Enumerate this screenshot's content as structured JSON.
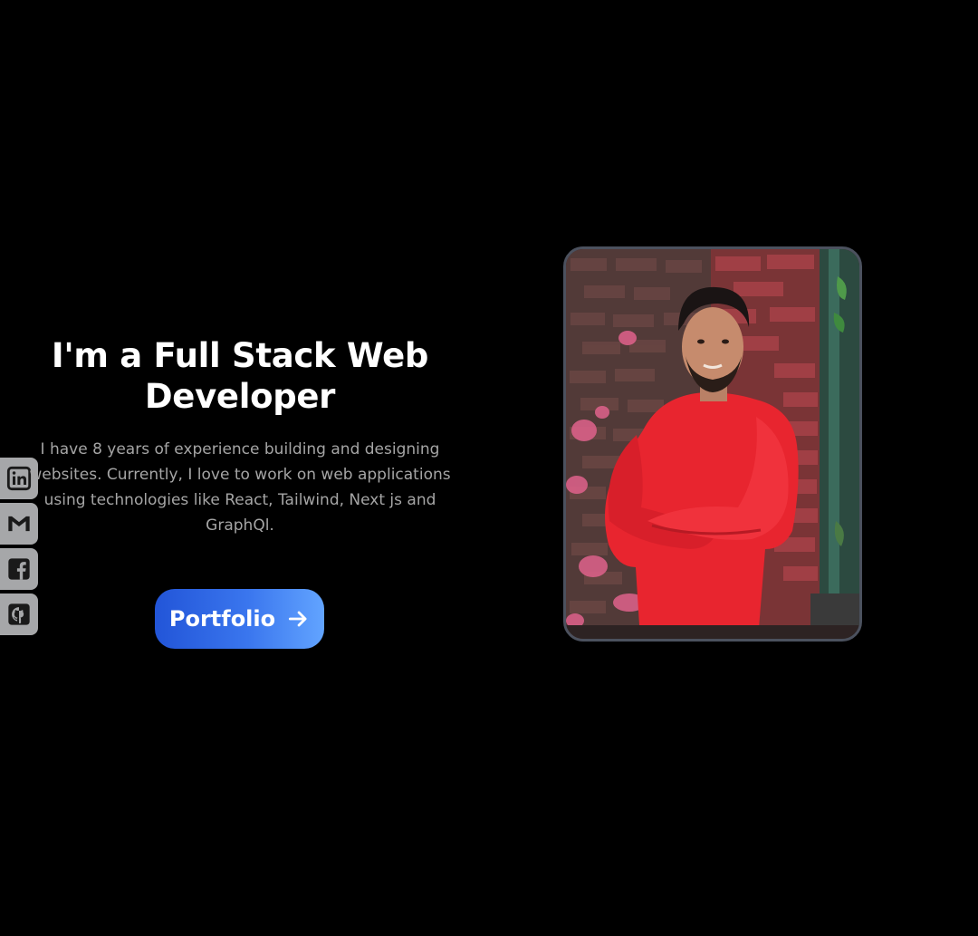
{
  "hero": {
    "title_line1": "I'm a Full Stack Web",
    "title_line2": "Developer",
    "description": "I have 8 years of experience building and designing websites. Currently, I love to work on web applications using technologies like React, Tailwind, Next js and GraphQl.",
    "cta_label": "Portfolio"
  },
  "social": [
    {
      "icon": "linkedin-icon"
    },
    {
      "icon": "gmail-icon"
    },
    {
      "icon": "facebook-icon"
    },
    {
      "icon": "github-icon"
    }
  ],
  "colors": {
    "background": "#000000",
    "accent_start": "#2255d8",
    "accent_end": "#62a4ff",
    "sidebar": "#a6a7a9",
    "frame_border": "#4b515e"
  }
}
